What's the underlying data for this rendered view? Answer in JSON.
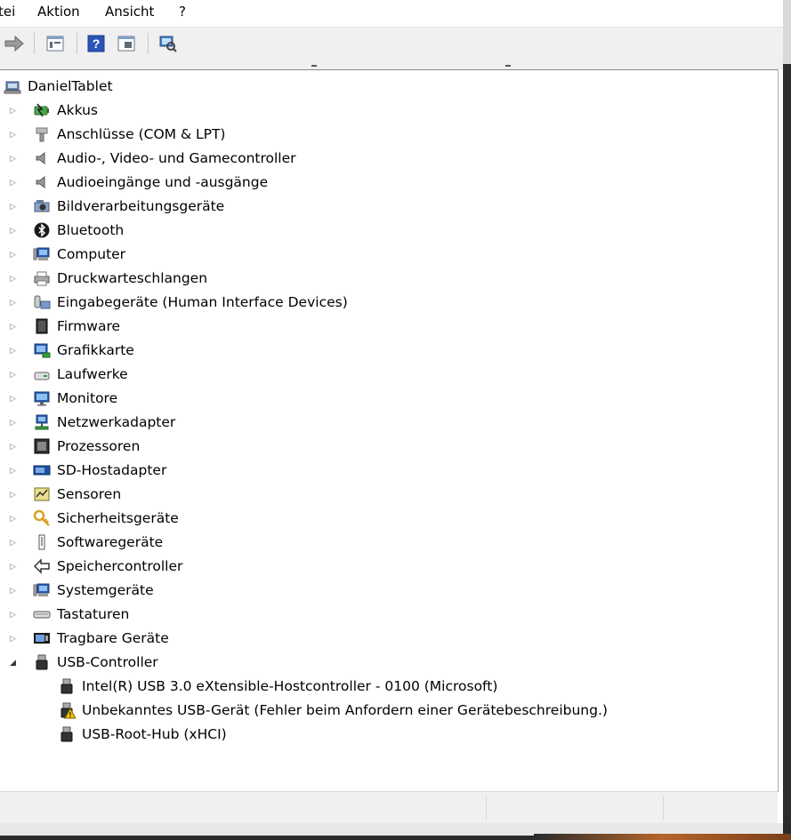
{
  "menubar": {
    "items": [
      "tei",
      "Aktion",
      "Ansicht",
      "?"
    ]
  },
  "tree": {
    "root": "DanielTablet",
    "categories": [
      {
        "label": "Akkus",
        "icon": "battery-icon"
      },
      {
        "label": "Anschlüsse (COM & LPT)",
        "icon": "port-icon"
      },
      {
        "label": "Audio-, Video- und Gamecontroller",
        "icon": "speaker-icon"
      },
      {
        "label": "Audioeingänge und -ausgänge",
        "icon": "speaker-icon"
      },
      {
        "label": "Bildverarbeitungsgeräte",
        "icon": "camera-icon"
      },
      {
        "label": "Bluetooth",
        "icon": "bluetooth-icon"
      },
      {
        "label": "Computer",
        "icon": "computer-icon"
      },
      {
        "label": "Druckwarteschlangen",
        "icon": "printer-icon"
      },
      {
        "label": "Eingabegeräte (Human Interface Devices)",
        "icon": "hid-icon"
      },
      {
        "label": "Firmware",
        "icon": "firmware-icon"
      },
      {
        "label": "Grafikkarte",
        "icon": "display-adapter-icon"
      },
      {
        "label": "Laufwerke",
        "icon": "disk-drive-icon"
      },
      {
        "label": "Monitore",
        "icon": "monitor-icon"
      },
      {
        "label": "Netzwerkadapter",
        "icon": "network-adapter-icon"
      },
      {
        "label": "Prozessoren",
        "icon": "processor-icon"
      },
      {
        "label": "SD-Hostadapter",
        "icon": "sd-host-icon"
      },
      {
        "label": "Sensoren",
        "icon": "sensor-icon"
      },
      {
        "label": "Sicherheitsgeräte",
        "icon": "security-key-icon"
      },
      {
        "label": "Softwaregeräte",
        "icon": "software-device-icon"
      },
      {
        "label": "Speichercontroller",
        "icon": "storage-controller-icon"
      },
      {
        "label": "Systemgeräte",
        "icon": "system-device-icon"
      },
      {
        "label": "Tastaturen",
        "icon": "keyboard-icon"
      },
      {
        "label": "Tragbare Geräte",
        "icon": "portable-device-icon"
      },
      {
        "label": "USB-Controller",
        "icon": "usb-icon",
        "expanded": true
      }
    ],
    "usb_children": [
      {
        "label": "Intel(R) USB 3.0 eXtensible-Hostcontroller - 0100 (Microsoft)",
        "icon": "usb-icon",
        "warning": false
      },
      {
        "label": "Unbekanntes USB-Gerät (Fehler beim Anfordern einer Gerätebeschreibung.)",
        "icon": "usb-warning-icon",
        "warning": true
      },
      {
        "label": "USB-Root-Hub (xHCI)",
        "icon": "usb-icon",
        "warning": false
      }
    ]
  },
  "colors": {
    "toolbar_bg": "#f0f0f0",
    "warning": "#f2c200",
    "accent": "#1e57b5"
  }
}
